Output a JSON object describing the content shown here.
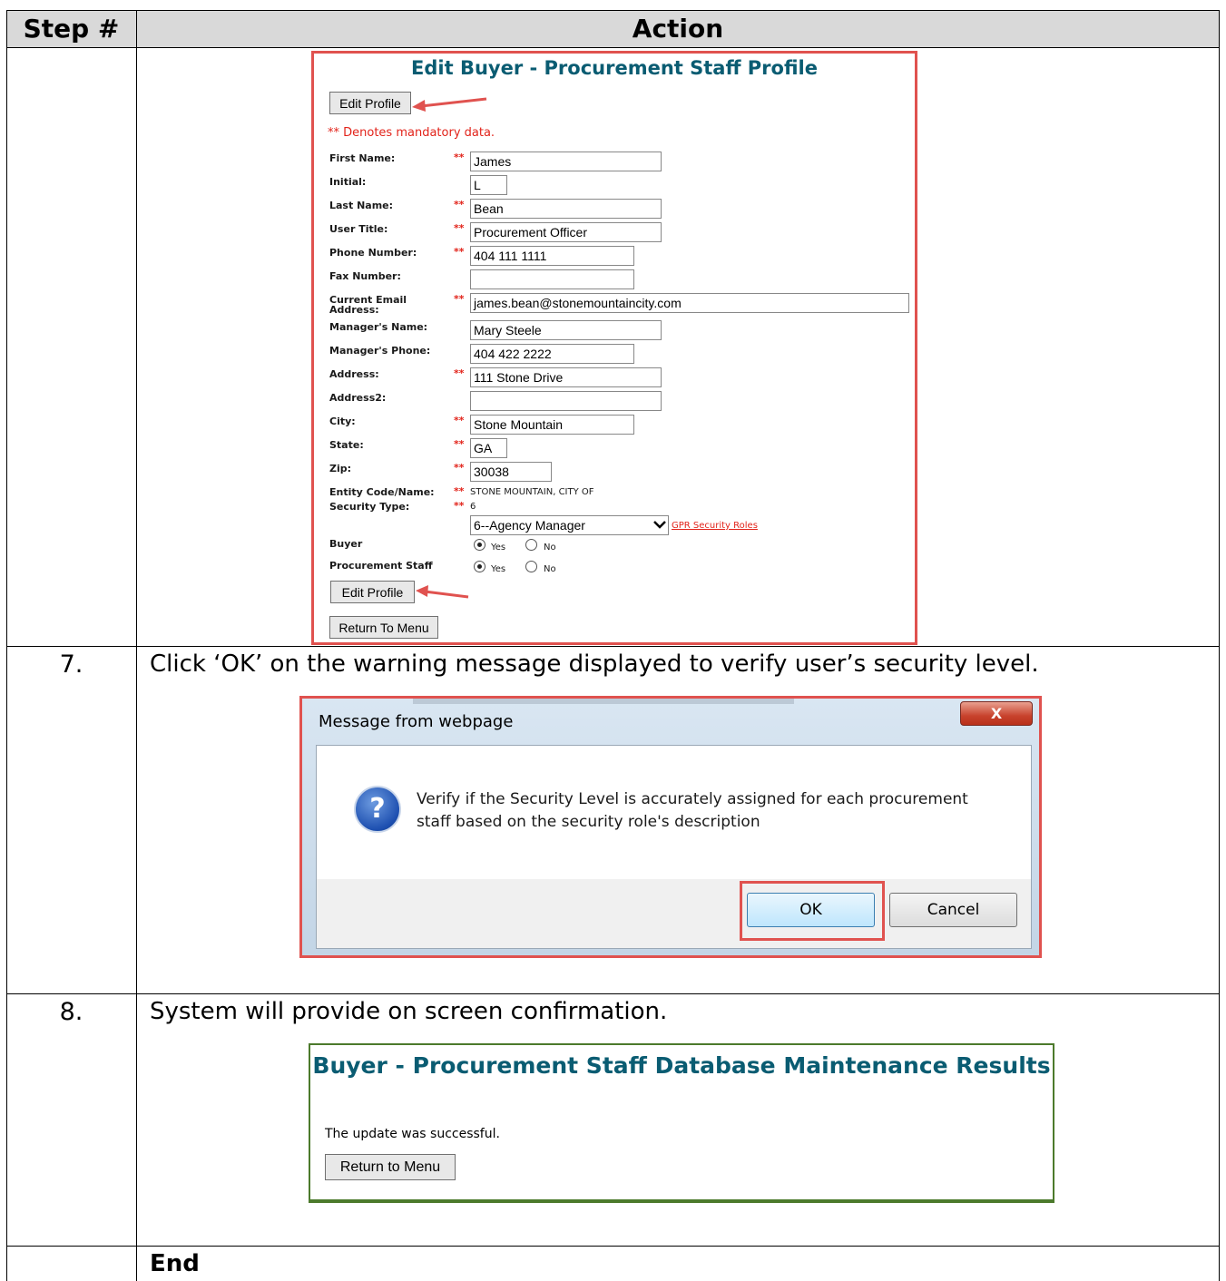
{
  "table": {
    "headers": {
      "step": "Step #",
      "action": "Action"
    },
    "rows": [
      {
        "step": "",
        "instruction": ""
      },
      {
        "step": "7.",
        "instruction": "Click ‘OK’ on the warning message displayed to verify user’s security level."
      },
      {
        "step": "8.",
        "instruction": "System will provide on screen confirmation."
      },
      {
        "step": "",
        "instruction": "End"
      }
    ]
  },
  "edit_form": {
    "title": "Edit Buyer - Procurement Staff Profile",
    "edit_profile_label": "Edit Profile",
    "mandatory_note": "** Denotes mandatory data.",
    "mandatory_marker": "**",
    "fields": {
      "first_name": {
        "label": "First Name:",
        "value": "James"
      },
      "initial": {
        "label": "Initial:",
        "value": "L"
      },
      "last_name": {
        "label": "Last Name:",
        "value": "Bean"
      },
      "user_title": {
        "label": "User Title:",
        "value": "Procurement Officer"
      },
      "phone": {
        "label": "Phone Number:",
        "value": "404 111 1111"
      },
      "fax": {
        "label": "Fax Number:",
        "value": ""
      },
      "email": {
        "label": "Current Email Address:",
        "value": "james.bean@stonemountaincity.com"
      },
      "manager_name": {
        "label": "Manager's Name:",
        "value": "Mary Steele"
      },
      "manager_phone": {
        "label": "Manager's Phone:",
        "value": "404 422 2222"
      },
      "address": {
        "label": "Address:",
        "value": "111 Stone Drive"
      },
      "address2": {
        "label": "Address2:",
        "value": ""
      },
      "city": {
        "label": "City:",
        "value": "Stone Mountain"
      },
      "state": {
        "label": "State:",
        "value": "GA"
      },
      "zip": {
        "label": "Zip:",
        "value": "30038"
      }
    },
    "entity": {
      "label": "Entity Code/Name:",
      "value": "STONE MOUNTAIN, CITY OF"
    },
    "security": {
      "label": "Security Type:",
      "value": "6",
      "selected": "6--Agency Manager",
      "link": "GPR Security Roles"
    },
    "buyer": {
      "label": "Buyer",
      "selected": "Yes"
    },
    "procurement_staff": {
      "label": "Procurement Staff",
      "selected": "Yes"
    },
    "radio_yes": "Yes",
    "radio_no": "No",
    "return_label": "Return To Menu"
  },
  "dialog": {
    "title": "Message from webpage",
    "close_label": "X",
    "icon": "question-icon",
    "icon_glyph": "?",
    "message": "Verify if the Security Level is accurately assigned for each procurement staff based on the security role's description",
    "ok_label": "OK",
    "cancel_label": "Cancel"
  },
  "confirmation": {
    "title": "Buyer - Procurement Staff Database Maintenance Results",
    "message": "The update was successful.",
    "return_label": "Return to Menu"
  },
  "colors": {
    "highlight": "#e0524f",
    "title_teal": "#0a5c72",
    "mandatory_red": "#e2231a",
    "confirm_border": "#4c7a2c",
    "header_gray": "#d9d9d9"
  }
}
